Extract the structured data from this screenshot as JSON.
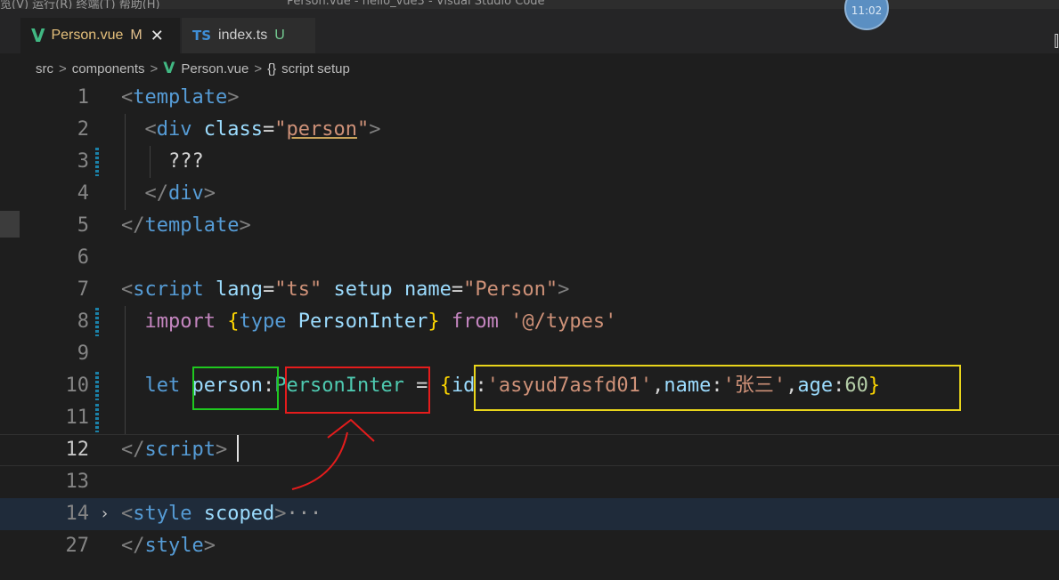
{
  "titlebar": {
    "menu_left": "览(V)  运行(R)  终端(T)  帮助(H)",
    "window_title": "Person.vue - hello_vue3 - Visual Studio Code",
    "clock": "11:02"
  },
  "tabs": [
    {
      "label": "Person.vue",
      "status": "M",
      "icon": "vue-logo-icon",
      "active": true
    },
    {
      "label": "index.ts",
      "status": "U",
      "icon": "ts-icon",
      "active": false
    }
  ],
  "breadcrumb": {
    "parts": [
      "src",
      "components",
      "Person.vue",
      "script setup"
    ],
    "brace_symbol": "{}"
  },
  "editor": {
    "lines": [
      {
        "n": "1",
        "segments": [
          [
            "punc",
            "<"
          ],
          [
            "tag",
            "template"
          ],
          [
            "punc",
            ">"
          ]
        ]
      },
      {
        "n": "2",
        "segments": [
          [
            "plain",
            "  "
          ],
          [
            "punc",
            "<"
          ],
          [
            "tag",
            "div"
          ],
          [
            "plain",
            " "
          ],
          [
            "attr",
            "class"
          ],
          [
            "plain",
            "="
          ],
          [
            "str",
            "\""
          ],
          [
            "str-sq",
            "person"
          ],
          [
            "str",
            "\""
          ],
          [
            "punc",
            ">"
          ]
        ]
      },
      {
        "n": "3",
        "segments": [
          [
            "plain",
            "    ???"
          ]
        ]
      },
      {
        "n": "4",
        "segments": [
          [
            "plain",
            "  "
          ],
          [
            "punc",
            "</"
          ],
          [
            "tag",
            "div"
          ],
          [
            "punc",
            ">"
          ]
        ]
      },
      {
        "n": "5",
        "segments": [
          [
            "punc",
            "</"
          ],
          [
            "tag",
            "template"
          ],
          [
            "punc",
            ">"
          ]
        ]
      },
      {
        "n": "6",
        "segments": []
      },
      {
        "n": "7",
        "segments": [
          [
            "punc",
            "<"
          ],
          [
            "tag",
            "script"
          ],
          [
            "plain",
            " "
          ],
          [
            "attr",
            "lang"
          ],
          [
            "plain",
            "="
          ],
          [
            "str",
            "\"ts\""
          ],
          [
            "plain",
            " "
          ],
          [
            "attr",
            "setup"
          ],
          [
            "plain",
            " "
          ],
          [
            "attr",
            "name"
          ],
          [
            "plain",
            "="
          ],
          [
            "str",
            "\"Person\""
          ],
          [
            "punc",
            ">"
          ]
        ]
      },
      {
        "n": "8",
        "segments": [
          [
            "plain",
            "  "
          ],
          [
            "kw",
            "import"
          ],
          [
            "plain",
            " "
          ],
          [
            "brace",
            "{"
          ],
          [
            "let",
            "type"
          ],
          [
            "plain",
            " "
          ],
          [
            "var",
            "PersonInter"
          ],
          [
            "brace",
            "}"
          ],
          [
            "plain",
            " "
          ],
          [
            "kw",
            "from"
          ],
          [
            "plain",
            " "
          ],
          [
            "str",
            "'@/types'"
          ]
        ]
      },
      {
        "n": "9",
        "segments": []
      },
      {
        "n": "10",
        "segments": [
          [
            "plain",
            "  "
          ],
          [
            "let",
            "let"
          ],
          [
            "plain",
            " "
          ],
          [
            "var",
            "person"
          ],
          [
            "plain",
            ":"
          ],
          [
            "type",
            "PersonInter"
          ],
          [
            "plain",
            " = "
          ],
          [
            "brace",
            "{"
          ],
          [
            "var",
            "id"
          ],
          [
            "plain",
            ":"
          ],
          [
            "str",
            "'asyud7asfd01'"
          ],
          [
            "plain",
            ","
          ],
          [
            "var",
            "name"
          ],
          [
            "plain",
            ":"
          ],
          [
            "str",
            "'张三'"
          ],
          [
            "plain",
            ","
          ],
          [
            "var",
            "age"
          ],
          [
            "plain",
            ":"
          ],
          [
            "num",
            "60"
          ],
          [
            "brace",
            "}"
          ]
        ]
      },
      {
        "n": "11",
        "segments": []
      },
      {
        "n": "12",
        "segments": [
          [
            "punc",
            "</"
          ],
          [
            "tag",
            "script"
          ],
          [
            "punc",
            ">"
          ]
        ]
      },
      {
        "n": "13",
        "segments": []
      },
      {
        "n": "14",
        "segments": [
          [
            "punc",
            "<"
          ],
          [
            "tag",
            "style"
          ],
          [
            "plain",
            " "
          ],
          [
            "attr",
            "scoped"
          ],
          [
            "punc",
            ">"
          ],
          [
            "ellipsis",
            "···"
          ]
        ]
      },
      {
        "n": "27",
        "segments": [
          [
            "punc",
            "</"
          ],
          [
            "tag",
            "style"
          ],
          [
            "punc",
            ">"
          ]
        ]
      }
    ],
    "active_line": "12",
    "folded_line": "14"
  },
  "annotations": {
    "box_colors": {
      "green": "#1fc81f",
      "red": "#e51c1c",
      "yellow": "#e9d51b"
    },
    "arrow_color": "#e51c1c"
  }
}
